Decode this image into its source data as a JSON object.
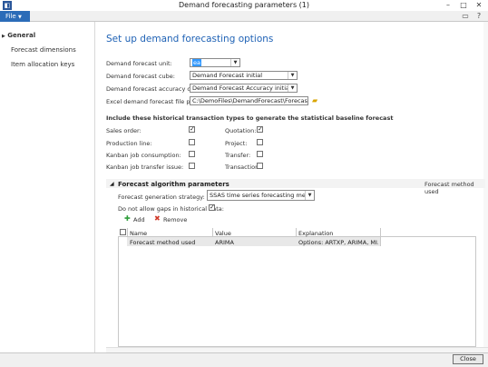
{
  "window": {
    "title": "Demand forecasting parameters (1)",
    "app_icon": "ax-icon"
  },
  "ribbon": {
    "file_label": "File"
  },
  "nav": {
    "items": [
      {
        "label": "General"
      },
      {
        "label": "Forecast dimensions"
      },
      {
        "label": "Item allocation keys"
      }
    ]
  },
  "main": {
    "title": "Set up demand forecasting options",
    "unit_label": "Demand forecast unit:",
    "unit_value": "ea",
    "cube_label": "Demand forecast cube:",
    "cube_value": "Demand Forecast initial",
    "acc_cube_label": "Demand forecast accuracy cube:",
    "acc_cube_value": "Demand Forecast Accuracy initial",
    "excel_label": "Excel demand forecast file path:",
    "excel_value": "C:\\DemoFiles\\DemandForecast\\Forecast.xlsx",
    "include_heading": "Include these historical transaction types to generate the statistical baseline forecast",
    "types": [
      {
        "label": "Sales order:",
        "checked": true
      },
      {
        "label": "Production line:",
        "checked": false
      },
      {
        "label": "Kanban job consumption:",
        "checked": false
      },
      {
        "label": "Kanban job transfer issue:",
        "checked": false
      },
      {
        "label": "Quotation:",
        "checked": true
      },
      {
        "label": "Project:",
        "checked": false
      },
      {
        "label": "Transfer:",
        "checked": false
      },
      {
        "label": "Transaction:",
        "checked": false
      }
    ]
  },
  "forecast": {
    "section_title": "Forecast algorithm parameters",
    "method_used": "Forecast method used",
    "strategy_label": "Forecast generation strategy:",
    "strategy_value": "SSAS time series forecasting methods",
    "gaps_label": "Do not allow gaps in historical data:",
    "gaps_checked": true,
    "add_label": "Add",
    "remove_label": "Remove",
    "columns": [
      "Name",
      "Value",
      "Explanation"
    ],
    "rows": [
      {
        "name": "Forecast method used",
        "value": "ARIMA",
        "explanation": "Options: ARTXP, ARIMA, MI..."
      }
    ]
  },
  "footer": {
    "close_label": "Close"
  },
  "colors": {
    "accent": "#1f62b5",
    "file_tab": "#2b6cb8",
    "selection": "#3399ff"
  }
}
